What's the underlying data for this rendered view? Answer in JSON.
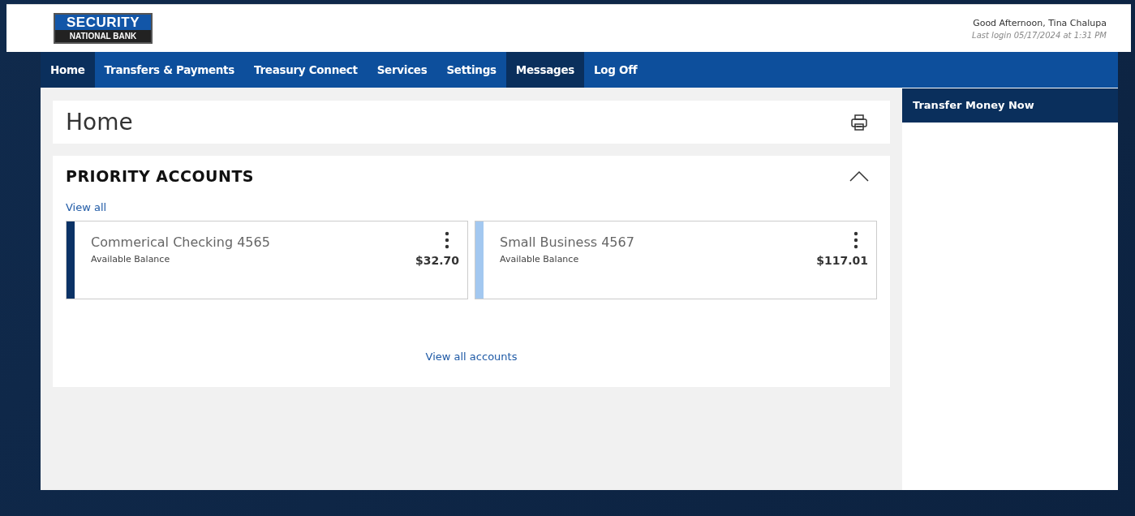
{
  "header": {
    "logo": {
      "line_1": "SECURITY",
      "line_2": "NATIONAL BANK"
    },
    "greeting": "Good Afternoon, Tina Chalupa",
    "last_login": "Last login 05/17/2024 at 1:31 PM"
  },
  "nav": [
    {
      "label": "Home",
      "selected": true
    },
    {
      "label": "Transfers & Payments",
      "selected": false
    },
    {
      "label": "Treasury Connect",
      "selected": false
    },
    {
      "label": "Services",
      "selected": false
    },
    {
      "label": "Settings",
      "selected": false
    },
    {
      "label": "Messages",
      "selected": true
    },
    {
      "label": "Log Off",
      "selected": false
    }
  ],
  "page_title": "Home",
  "priority_accounts": {
    "title": "PRIORITY ACCOUNTS",
    "expanded": true,
    "view_all": "View all",
    "accounts": [
      {
        "name": "Commerical Checking 4565",
        "balance_label": "Available Balance",
        "balance": "$32.70",
        "color": "#0b3266"
      },
      {
        "name": "Small Business 4567",
        "balance_label": "Available Balance",
        "balance": "$117.01",
        "color": "#a3c8f0"
      }
    ],
    "view_all_accounts": "View all accounts"
  },
  "sidebar": {
    "title": "Transfer Money Now"
  }
}
